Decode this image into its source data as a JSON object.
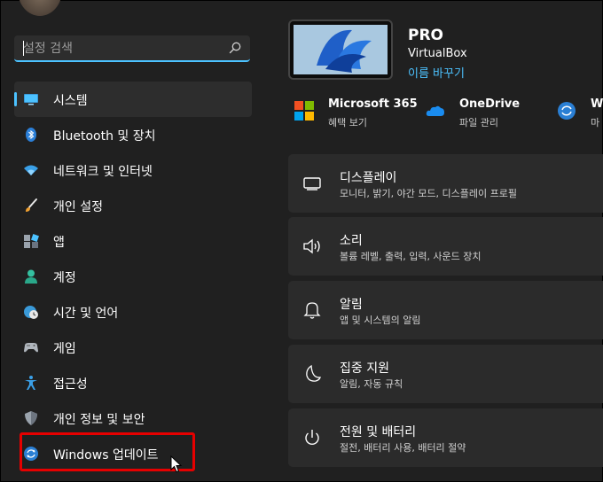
{
  "search": {
    "placeholder": "설정 검색"
  },
  "sidebar": {
    "items": [
      {
        "label": "시스템",
        "icon": "monitor-icon"
      },
      {
        "label": "Bluetooth 및 장치",
        "icon": "bluetooth-icon"
      },
      {
        "label": "네트워크 및 인터넷",
        "icon": "wifi-icon"
      },
      {
        "label": "개인 설정",
        "icon": "brush-icon"
      },
      {
        "label": "앱",
        "icon": "apps-icon"
      },
      {
        "label": "계정",
        "icon": "account-icon"
      },
      {
        "label": "시간 및 언어",
        "icon": "clock-globe-icon"
      },
      {
        "label": "게임",
        "icon": "gamepad-icon"
      },
      {
        "label": "접근성",
        "icon": "accessibility-icon"
      },
      {
        "label": "개인 정보 및 보안",
        "icon": "shield-icon"
      },
      {
        "label": "Windows 업데이트",
        "icon": "update-icon"
      }
    ]
  },
  "device": {
    "name": "PRO",
    "model": "VirtualBox",
    "rename_label": "이름 바꾸기"
  },
  "quick_links": [
    {
      "title": "Microsoft 365",
      "subtitle": "혜택 보기",
      "icon": "microsoft365-icon"
    },
    {
      "title": "OneDrive",
      "subtitle": "파일 관리",
      "icon": "onedrive-icon"
    },
    {
      "title": "W",
      "subtitle": "마",
      "icon": "windows-update-icon"
    }
  ],
  "cards": [
    {
      "title": "디스플레이",
      "subtitle": "모니터, 밝기, 야간 모드, 디스플레이 프로필",
      "icon": "display-icon"
    },
    {
      "title": "소리",
      "subtitle": "볼륨 레벨, 출력, 입력, 사운드 장치",
      "icon": "speaker-icon"
    },
    {
      "title": "알림",
      "subtitle": "앱 및 시스템의 알림",
      "icon": "bell-icon"
    },
    {
      "title": "집중 지원",
      "subtitle": "알림, 자동 규칙",
      "icon": "moon-icon"
    },
    {
      "title": "전원 및 배터리",
      "subtitle": "절전, 배터리 사용, 배터리 절약",
      "icon": "power-icon"
    }
  ],
  "colors": {
    "accent": "#4cc2ff",
    "highlight_box": "#e60000",
    "background": "#202020",
    "card": "#2b2b2b"
  }
}
